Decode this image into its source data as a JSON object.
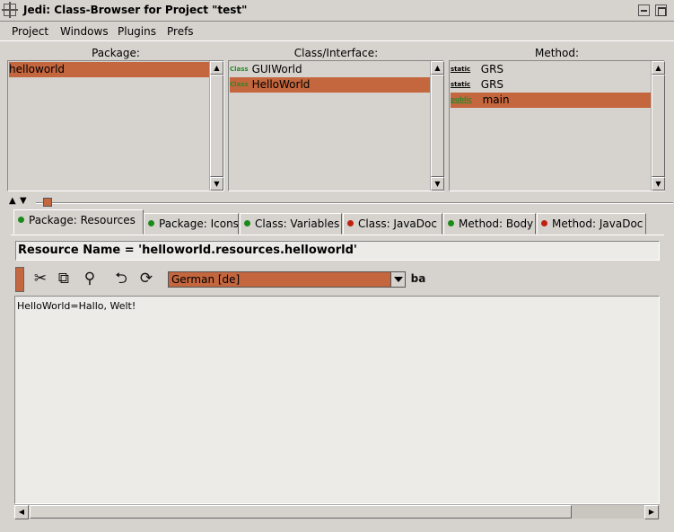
{
  "window": {
    "title": "Jedi: Class-Browser for Project \"test\""
  },
  "menu": [
    "Project",
    "Windows",
    "Plugins",
    "Prefs"
  ],
  "panels": {
    "package": {
      "title": "Package:",
      "items": [
        {
          "label": "helloworld",
          "selected": true
        }
      ]
    },
    "class": {
      "title": "Class/Interface:",
      "items": [
        {
          "tag": "Class",
          "label": "GUIWorld",
          "selected": false
        },
        {
          "tag": "Class",
          "label": "HelloWorld",
          "selected": true
        }
      ]
    },
    "method": {
      "title": "Method:",
      "items": [
        {
          "tag": "static",
          "label": "GRS",
          "selected": false
        },
        {
          "tag": "static",
          "label": "GRS",
          "selected": false
        },
        {
          "tag": "public",
          "label": "main",
          "selected": true
        }
      ]
    }
  },
  "tabs": [
    {
      "label": "Package: Resources",
      "dot": "green",
      "active": true
    },
    {
      "label": "Package: Icons",
      "dot": "green",
      "active": false
    },
    {
      "label": "Class: Variables",
      "dot": "green",
      "active": false
    },
    {
      "label": "Class: JavaDoc",
      "dot": "red",
      "active": false
    },
    {
      "label": "Method: Body",
      "dot": "green",
      "active": false
    },
    {
      "label": "Method: JavaDoc",
      "dot": "red",
      "active": false
    }
  ],
  "resource": {
    "name": "Resource Name = 'helloworld.resources.helloworld'"
  },
  "toolbar": {
    "icons": [
      "cut-icon",
      "copy-icon",
      "paste-icon",
      "undo-icon",
      "redo-icon",
      "translate-icon"
    ],
    "language": "German [de]",
    "translate_glyph": "ba"
  },
  "editor": {
    "content": "HelloWorld=Hallo, Welt!"
  },
  "colors": {
    "selection": "#c4663e",
    "background": "#d6d3ce",
    "status_green": "#1a8a1a",
    "status_red": "#c02010"
  }
}
